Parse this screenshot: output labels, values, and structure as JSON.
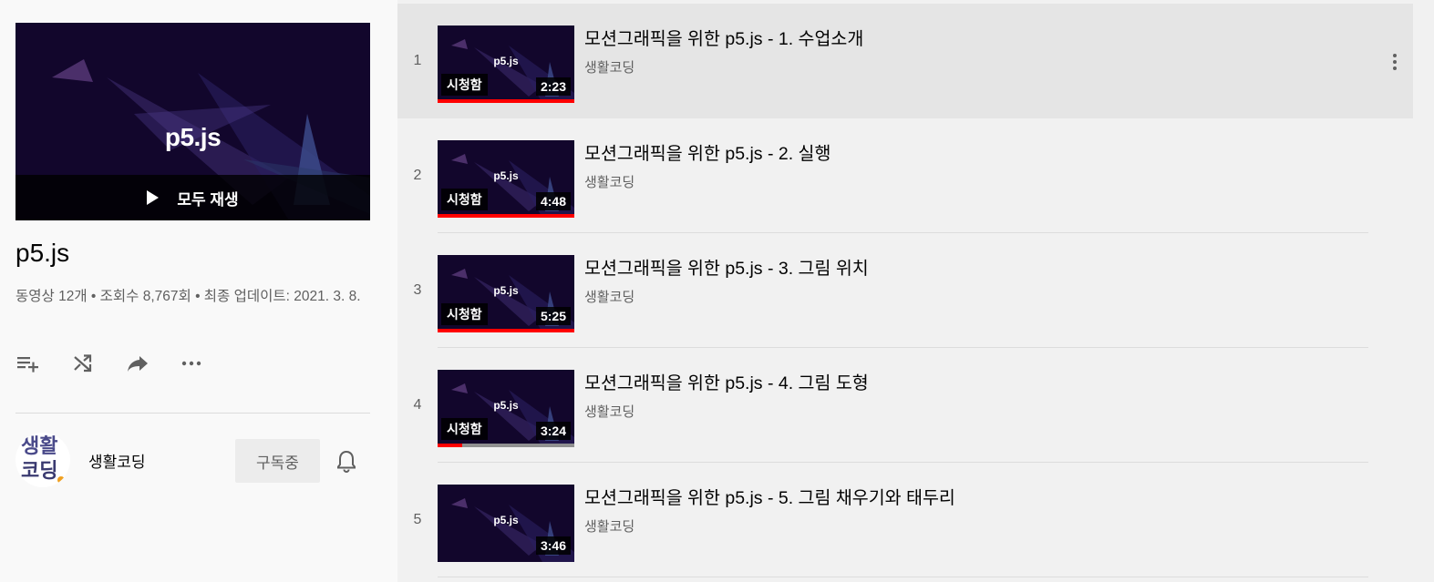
{
  "playlist": {
    "hero_logo": "p5.js",
    "play_all_label": "모두 재생",
    "title": "p5.js",
    "stats": "동영상 12개 • 조회수 8,767회 • 최종 업데이트: 2021. 3. 8.",
    "actions": [
      {
        "icon": "add-to-queue-icon"
      },
      {
        "icon": "shuffle-icon"
      },
      {
        "icon": "share-icon"
      },
      {
        "icon": "more-horizontal-icon"
      }
    ]
  },
  "owner": {
    "avatar_text_top": "생활",
    "avatar_text_bottom": "코딩",
    "name": "생활코딩",
    "subscribe_label": "구독중",
    "bell_icon": "bell-icon"
  },
  "videos": [
    {
      "index": "1",
      "title": "모션그래픽을 위한 p5.js - 1. 수업소개",
      "channel": "생활코딩",
      "duration": "2:23",
      "watched": "시청함",
      "progress": 1.0,
      "thumb_logo": "p5.js"
    },
    {
      "index": "2",
      "title": "모션그래픽을 위한 p5.js - 2. 실행",
      "channel": "생활코딩",
      "duration": "4:48",
      "watched": "시청함",
      "progress": 1.0,
      "thumb_logo": "p5.js"
    },
    {
      "index": "3",
      "title": "모션그래픽을 위한 p5.js - 3. 그림 위치",
      "channel": "생활코딩",
      "duration": "5:25",
      "watched": "시청함",
      "progress": 1.0,
      "thumb_logo": "p5.js"
    },
    {
      "index": "4",
      "title": "모션그래픽을 위한 p5.js - 4. 그림 도형",
      "channel": "생활코딩",
      "duration": "3:24",
      "watched": "시청함",
      "progress": 0.18,
      "thumb_logo": "p5.js"
    },
    {
      "index": "5",
      "title": "모션그래픽을 위한 p5.js - 5. 그림 채우기와 태두리",
      "channel": "생활코딩",
      "duration": "3:46",
      "watched": "",
      "progress": 0,
      "thumb_logo": "p5.js"
    }
  ],
  "colors": {
    "progress": "#ff0000",
    "thumb_bg": "#12062c",
    "hover_row": "#e5e5e5"
  }
}
